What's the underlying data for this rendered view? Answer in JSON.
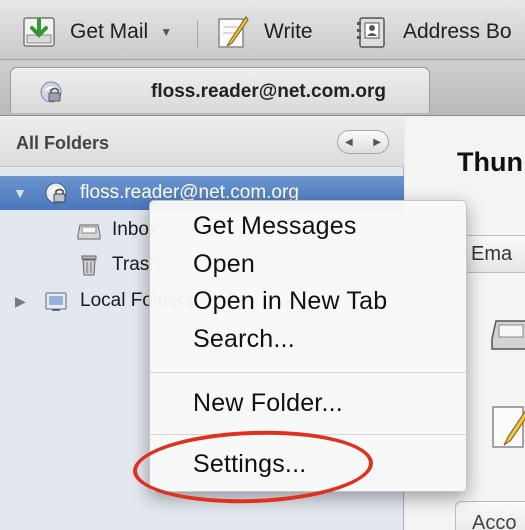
{
  "toolbar": {
    "get_mail": "Get Mail",
    "write": "Write",
    "address_book": "Address Bo"
  },
  "account_tab": {
    "label": "floss.reader@net.com.org"
  },
  "folder_pane": {
    "title": "All Folders",
    "account": "floss.reader@net.com.org",
    "inbox": "Inbox",
    "trash": "Trash",
    "local_folders": "Local Folders"
  },
  "main": {
    "title": "Thun",
    "email_button": "Ema",
    "accounts_button": "Acco"
  },
  "context_menu": {
    "items": [
      "Get Messages",
      "Open",
      "Open in New Tab",
      "Search...",
      "New Folder...",
      "Settings..."
    ]
  },
  "colors": {
    "selection": "#4a77ba",
    "highlight_ring": "#e0301e"
  },
  "icons": [
    "get-mail-icon",
    "write-icon",
    "address-book-icon",
    "account-icon",
    "inbox-icon",
    "trash-icon",
    "local-folders-icon"
  ]
}
